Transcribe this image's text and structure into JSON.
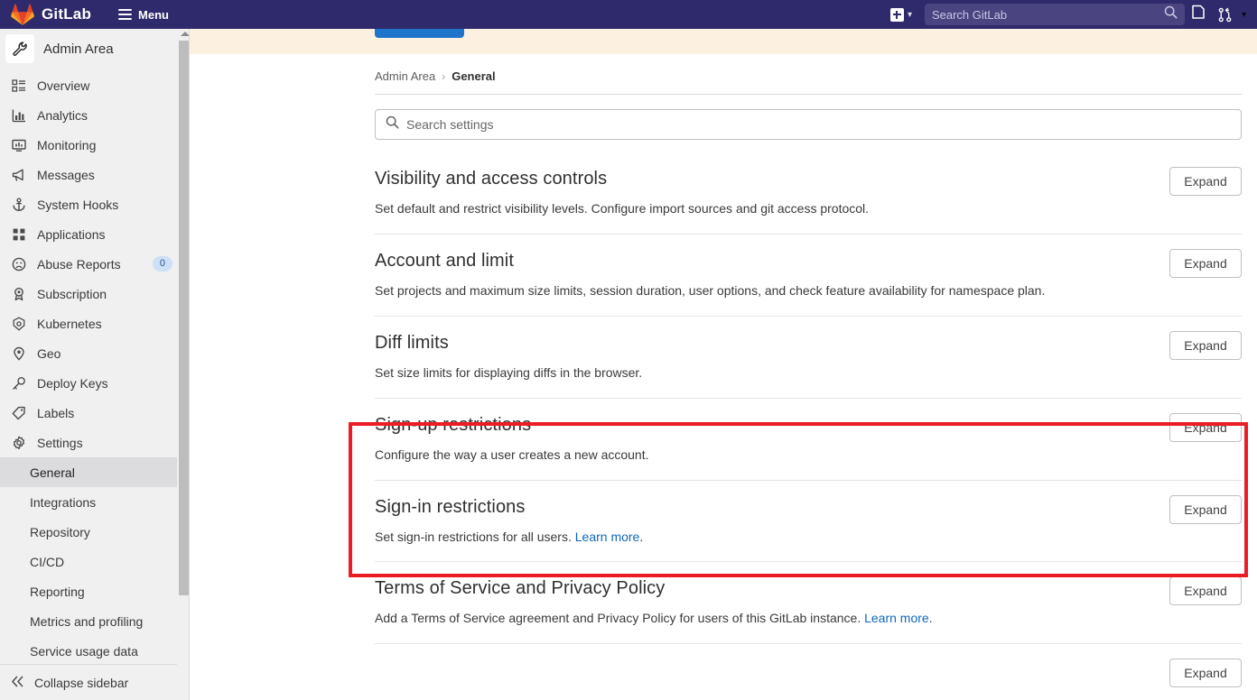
{
  "navbar": {
    "brand": "GitLab",
    "menu_label": "Menu",
    "logo_icon": "gitlab-tanuki-icon",
    "hamburger_icon": "hamburger-icon",
    "create_new_icon": "plus-square-icon",
    "create_new_chevron": "chevron-down-icon",
    "search_placeholder": "Search GitLab",
    "search_icon": "search-icon",
    "todos_icon": "todo-list-icon",
    "merge_requests_icon": "merge-request-icon",
    "merge_requests_chevron": "chevron-down-icon",
    "bg_color": "#2f2a6b",
    "search_bg_color": "#4a4580"
  },
  "sidebar": {
    "header": {
      "label": "Admin Area",
      "icon": "wrench-icon"
    },
    "items": [
      {
        "label": "Overview",
        "icon": "overview-list-icon"
      },
      {
        "label": "Analytics",
        "icon": "chart-bar-icon"
      },
      {
        "label": "Monitoring",
        "icon": "monitor-icon"
      },
      {
        "label": "Messages",
        "icon": "megaphone-icon"
      },
      {
        "label": "System Hooks",
        "icon": "anchor-icon"
      },
      {
        "label": "Applications",
        "icon": "grid-squares-icon"
      },
      {
        "label": "Abuse Reports",
        "icon": "frowning-face-icon",
        "badge": "0"
      },
      {
        "label": "Subscription",
        "icon": "license-badge-icon"
      },
      {
        "label": "Kubernetes",
        "icon": "kubernetes-icon"
      },
      {
        "label": "Geo",
        "icon": "location-pin-icon"
      },
      {
        "label": "Deploy Keys",
        "icon": "key-icon"
      },
      {
        "label": "Labels",
        "icon": "label-tag-icon"
      },
      {
        "label": "Settings",
        "icon": "gear-icon"
      }
    ],
    "sub_items": [
      {
        "label": "General",
        "active": true
      },
      {
        "label": "Integrations",
        "active": false
      },
      {
        "label": "Repository",
        "active": false
      },
      {
        "label": "CI/CD",
        "active": false
      },
      {
        "label": "Reporting",
        "active": false
      },
      {
        "label": "Metrics and profiling",
        "active": false
      },
      {
        "label": "Service usage data",
        "active": false
      }
    ],
    "collapse": {
      "label": "Collapse sidebar",
      "icon": "double-chevron-left-icon"
    },
    "badge_bg_color": "#cde0f7",
    "active_bg_color": "#dcdcde"
  },
  "content": {
    "banner": {
      "bg_color": "#fcf1e1",
      "button_color": "#1f75cb"
    },
    "breadcrumb": {
      "root": "Admin Area",
      "separator": "›",
      "current": "General"
    },
    "search_settings": {
      "placeholder": "Search settings",
      "icon": "search-icon"
    },
    "sections": [
      {
        "title": "Visibility and access controls",
        "description": "Set default and restrict visibility levels. Configure import sources and git access protocol.",
        "button": "Expand"
      },
      {
        "title": "Account and limit",
        "description": "Set projects and maximum size limits, session duration, user options, and check feature availability for namespace plan.",
        "button": "Expand"
      },
      {
        "title": "Diff limits",
        "description": "Set size limits for displaying diffs in the browser.",
        "button": "Expand"
      },
      {
        "title": "Sign-up restrictions",
        "description": "Configure the way a user creates a new account.",
        "button": "Expand"
      },
      {
        "title": "Sign-in restrictions",
        "description": "Set sign-in restrictions for all users.",
        "link": "Learn more",
        "link_suffix": ".",
        "button": "Expand"
      },
      {
        "title": "Terms of Service and Privacy Policy",
        "description": "Add a Terms of Service agreement and Privacy Policy for users of this GitLab instance.",
        "link": "Learn more",
        "link_suffix": ".",
        "button": "Expand"
      }
    ]
  },
  "annotation": {
    "highlight_color": "#ec1c24",
    "highlight_target": "sign-up-and-sign-in-restrictions"
  }
}
